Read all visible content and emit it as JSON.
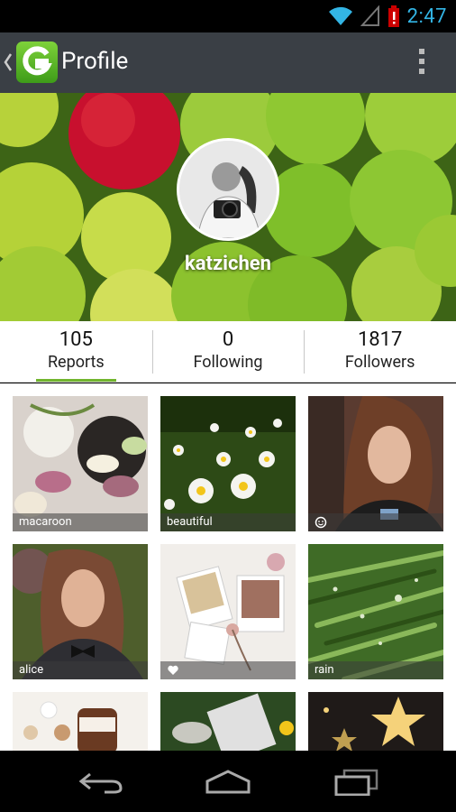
{
  "status_bar": {
    "time": "2:47"
  },
  "action_bar": {
    "title": "Profile",
    "logo_icon": "gleam-logo-icon"
  },
  "profile": {
    "username": "katzichen"
  },
  "stats": [
    {
      "value": "105",
      "label": "Reports"
    },
    {
      "value": "0",
      "label": "Following"
    },
    {
      "value": "1817",
      "label": "Followers"
    }
  ],
  "tiles": [
    {
      "caption": "macaroon",
      "colors": [
        "#d9d2cc",
        "#a56a7d",
        "#6b8a40"
      ]
    },
    {
      "caption": "beautiful",
      "colors": [
        "#2d4a16",
        "#e8e6b8",
        "#f2d33a"
      ]
    },
    {
      "caption": "",
      "badge_icon": "smiley-icon",
      "colors": [
        "#3b2a24",
        "#9b6e55",
        "#111"
      ]
    },
    {
      "caption": "alice",
      "colors": [
        "#5c6e3a",
        "#b38468",
        "#222"
      ]
    },
    {
      "caption": "",
      "badge_icon": "heart-icon",
      "colors": [
        "#f1eeea",
        "#d4a48a",
        "#8a6b5a"
      ]
    },
    {
      "caption": "rain",
      "colors": [
        "#4a7a2a",
        "#7aa24a",
        "#1d3a12"
      ]
    },
    {
      "caption": "",
      "colors": [
        "#f4f1ec",
        "#7a4b2a",
        "#e8d2b0"
      ]
    },
    {
      "caption": "",
      "colors": [
        "#2c4a22",
        "#e0e0e0",
        "#3a6a2a"
      ]
    },
    {
      "caption": "",
      "colors": [
        "#1f1a18",
        "#f5d27a",
        "#6a4a3a"
      ]
    }
  ],
  "colors": {
    "accent": "#72b62f",
    "actionbar": "#3a3f45",
    "clock": "#33b5e5"
  }
}
